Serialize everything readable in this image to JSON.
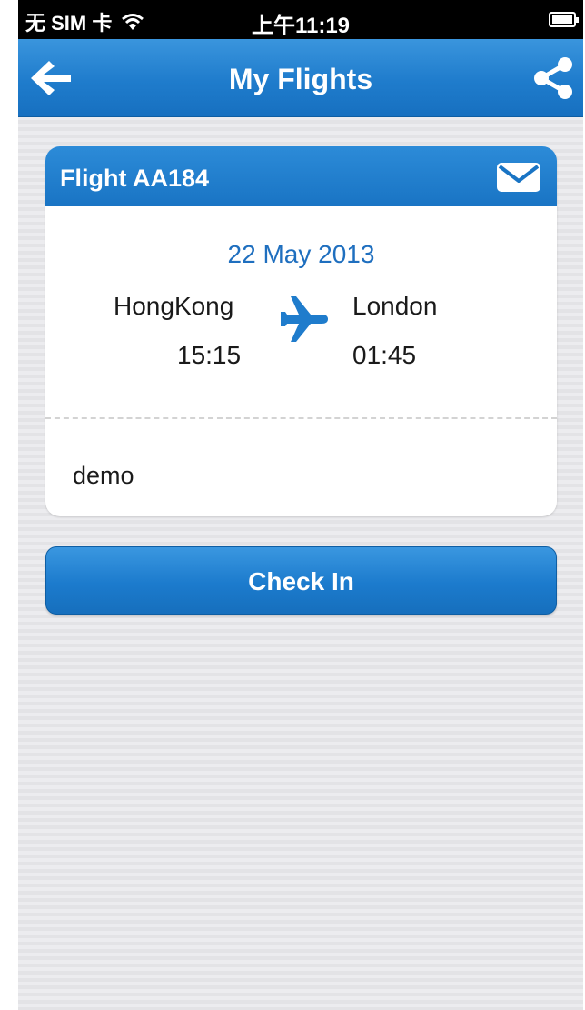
{
  "status_bar": {
    "carrier": "无 SIM 卡",
    "time": "上午11:19",
    "wifi_icon": "wifi-icon",
    "battery_icon": "battery-charging-icon"
  },
  "nav": {
    "title": "My Flights",
    "back_icon": "back-arrow-icon",
    "share_icon": "share-icon"
  },
  "flight": {
    "title": "Flight AA184",
    "mail_icon": "mail-icon",
    "date": "22 May 2013",
    "from": "HongKong",
    "to": "London",
    "departure_time": "15:15",
    "arrival_time": "01:45",
    "plane_icon": "airplane-icon",
    "note": "demo"
  },
  "actions": {
    "check_in_label": "Check In"
  },
  "colors": {
    "accent": "#1f7ccc",
    "date_text": "#1f6fbf"
  }
}
